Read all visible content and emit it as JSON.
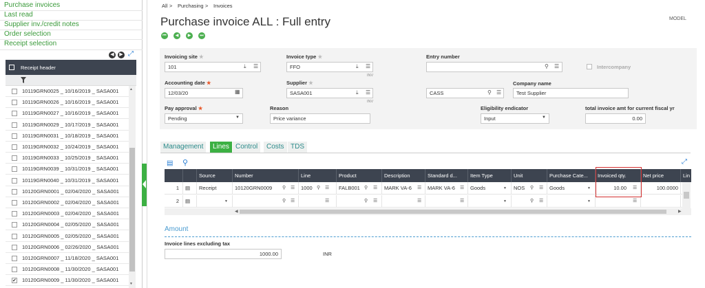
{
  "left_panel": {
    "links": [
      "Purchase invoices",
      "Last read",
      "Supplier inv./credit notes",
      "Order selection",
      "Receipt selection"
    ],
    "nav": {
      "prev": "◀",
      "next": "▶",
      "expand": "⤢"
    },
    "header_label": "Receipt header",
    "rows": [
      {
        "text": "10119GRN0025 _ 10/16/2019 _ SASA001",
        "checked": false
      },
      {
        "text": "10119GRN0026 _ 10/16/2019 _ SASA001",
        "checked": false
      },
      {
        "text": "10119GRN0027 _ 10/16/2019 _ SASA001",
        "checked": false
      },
      {
        "text": "10119GRN0029 _ 10/17/2019 _ SASA001",
        "checked": false
      },
      {
        "text": "10119GRN0031 _ 10/18/2019 _ SASA001",
        "checked": false
      },
      {
        "text": "10119GRN0032 _ 10/24/2019 _ SASA001",
        "checked": false
      },
      {
        "text": "10119GRN0033 _ 10/25/2019 _ SASA001",
        "checked": false
      },
      {
        "text": "10119GRN0039 _ 10/31/2019 _ SASA001",
        "checked": false
      },
      {
        "text": "10119GRN0040 _ 10/31/2019 _ SASA001",
        "checked": false
      },
      {
        "text": "10120GRN0001 _ 02/04/2020 _ SASA001",
        "checked": false
      },
      {
        "text": "10120GRN0002 _ 02/04/2020 _ SASA001",
        "checked": false
      },
      {
        "text": "10120GRN0003 _ 02/04/2020 _ SASA001",
        "checked": false
      },
      {
        "text": "10120GRN0004 _ 02/05/2020 _ SASA001",
        "checked": false
      },
      {
        "text": "10120GRN0005 _ 02/05/2020 _ SASA001",
        "checked": false
      },
      {
        "text": "10120GRN0006 _ 02/26/2020 _ SASA001",
        "checked": false
      },
      {
        "text": "10120GRN0007 _ 11/18/2020 _ SASA001",
        "checked": false
      },
      {
        "text": "10120GRN0008 _ 11/30/2020 _ SASA001",
        "checked": false
      },
      {
        "text": "10120GRN0009 _ 11/30/2020 _ SASA001",
        "checked": true
      }
    ]
  },
  "breadcrumb": {
    "items": [
      "All",
      ">",
      "Purchasing",
      ">",
      "Invoices"
    ]
  },
  "page": {
    "title": "Purchase invoice ALL : Full entry",
    "mode": "MODEL"
  },
  "nav_buttons": [
    "⏮",
    "◀",
    "▶",
    "⏭"
  ],
  "header": {
    "invoicing_site": {
      "label": "Invoicing site",
      "value": "101"
    },
    "invoice_type": {
      "label": "Invoice type",
      "value": "FFO",
      "sub": "INV"
    },
    "entry_number": {
      "label": "Entry number",
      "value": ""
    },
    "intercompany": {
      "label": "Intercompany"
    },
    "accounting_date": {
      "label": "Accounting date",
      "value": "12/03/20"
    },
    "supplier": {
      "label": "Supplier",
      "value": "SASA001",
      "sub": "INV"
    },
    "supplier_name": {
      "value": "CASS"
    },
    "company_name": {
      "label": "Company name",
      "value": "Test Supplier"
    },
    "pay_approval": {
      "label": "Pay approval",
      "value": "Pending"
    },
    "reason": {
      "label": "Reason",
      "value": "Price variance"
    },
    "eligibility": {
      "label": "Eligibility endicator",
      "value": "Input"
    },
    "total_amt": {
      "label": "total invoice amt for current fiscal yr",
      "value": "0.00"
    }
  },
  "tabs": [
    "Management",
    "Lines",
    "Control",
    "Costs",
    "TDS"
  ],
  "active_tab": "Lines",
  "grid": {
    "columns": [
      "",
      "Source",
      "Number",
      "Line",
      "Product",
      "Description",
      "Standard d...",
      "Item Type",
      "Unit",
      "Purchase Cate...",
      "Invoiced qty.",
      "Net price",
      "Lin"
    ],
    "rows": [
      {
        "num": "1",
        "source": "Receipt",
        "number": "10120GRN0009",
        "line": "1000",
        "product": "FALB001",
        "description": "MARK VA-6",
        "standard": "MARK VA-6",
        "item_type": "Goods",
        "unit": "NOS",
        "purchase_cat": "Goods",
        "invoiced_qty": "10.00",
        "net_price": "100.0000"
      },
      {
        "num": "2",
        "source": "",
        "number": "",
        "line": "",
        "product": "",
        "description": "",
        "standard": "",
        "item_type": "",
        "unit": "",
        "purchase_cat": "",
        "invoiced_qty": "",
        "net_price": ""
      }
    ]
  },
  "amount": {
    "title": "Amount",
    "label": "Invoice lines excluding tax",
    "value": "1000.00",
    "currency": "INR"
  }
}
